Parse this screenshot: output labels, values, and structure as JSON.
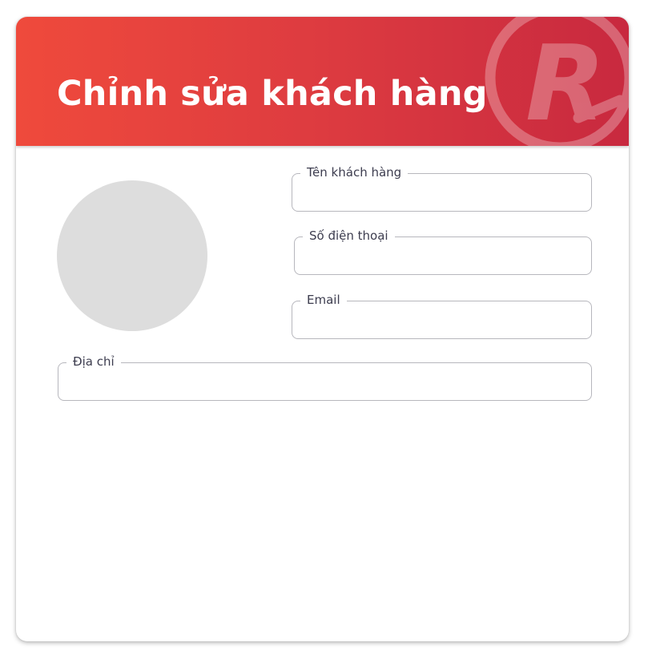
{
  "header": {
    "title": "Chỉnh sửa khách hàng",
    "logo_icon": "registered-r-icon",
    "gradient_colors": [
      "#ef4a3c",
      "#c8293f"
    ]
  },
  "avatar": {
    "placeholder_color": "#dddddd"
  },
  "form": {
    "customer_name": {
      "label": "Tên khách hàng",
      "value": ""
    },
    "phone": {
      "label": "Số điện thoại",
      "value": ""
    },
    "email": {
      "label": "Email",
      "value": ""
    },
    "address": {
      "label": "Địa chỉ",
      "value": ""
    }
  }
}
